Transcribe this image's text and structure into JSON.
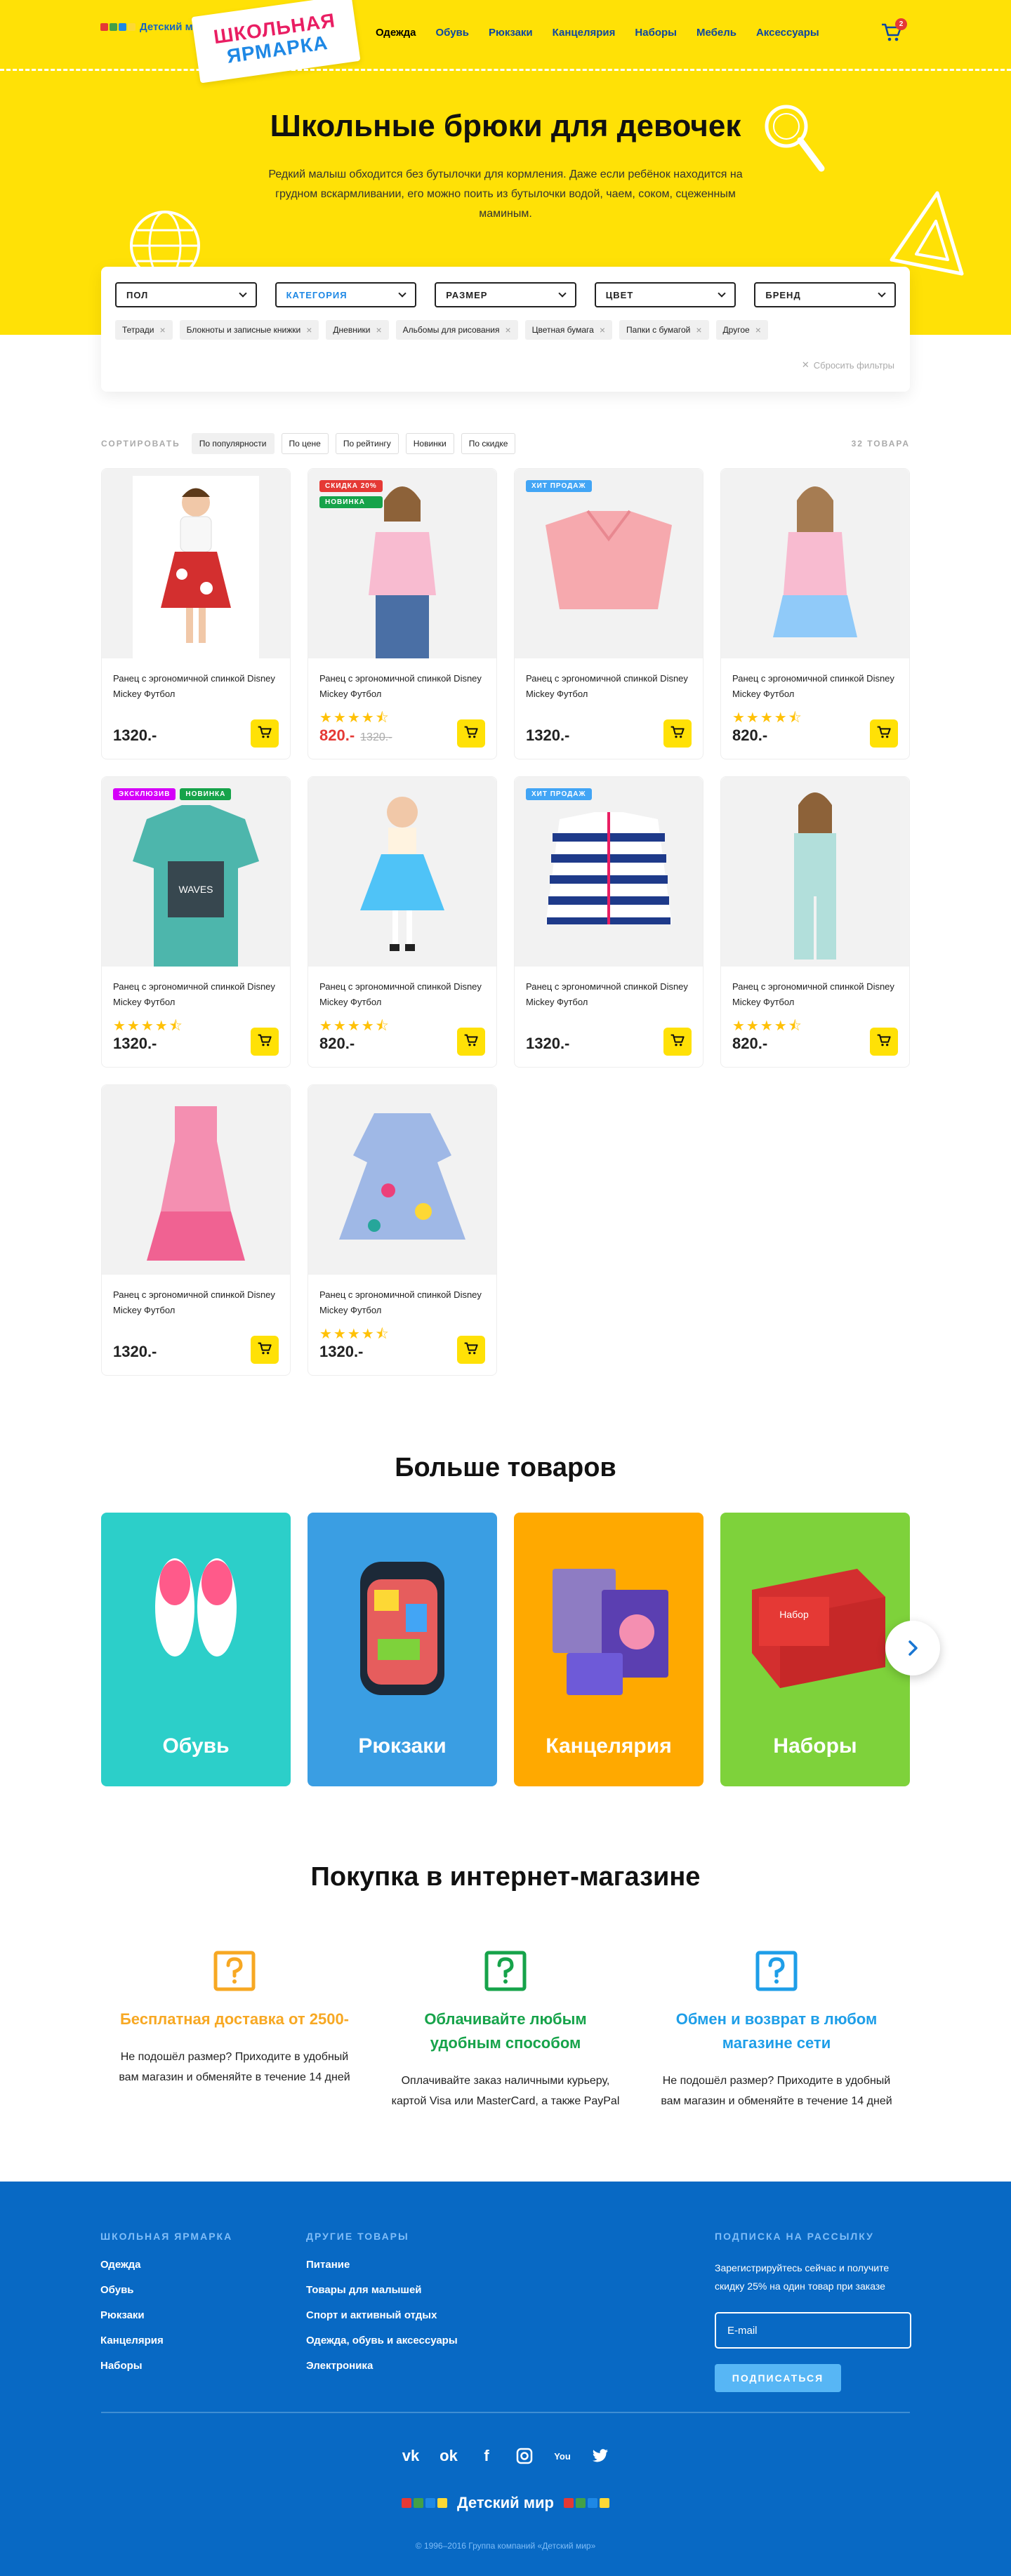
{
  "header": {
    "brand": "Детский мир",
    "badge_line1": "ШКОЛЬНАЯ",
    "badge_line2": "ЯРМАРКА",
    "nav": [
      "Одежда",
      "Обувь",
      "Рюкзаки",
      "Канцелярия",
      "Наборы",
      "Мебель",
      "Аксессуары"
    ],
    "cart_count": "2"
  },
  "hero": {
    "title": "Школьные брюки для девочек",
    "description": "Редкий малыш обходится без бутылочки для кормления. Даже если ребёнок находится на грудном вскармливании, его можно поить из бутылочки водой, чаем, соком, сцеженным маминым."
  },
  "filters": {
    "selects": [
      "ПОЛ",
      "КАТЕГОРИЯ",
      "РАЗМЕР",
      "ЦВЕТ",
      "БРЕНД"
    ],
    "tags": [
      "Тетради",
      "Блокноты и записные книжки",
      "Дневники",
      "Альбомы для рисования",
      "Цветная бумага",
      "Папки с бумагой",
      "Другое"
    ],
    "reset": "Сбросить фильтры"
  },
  "sort": {
    "label": "СОРТИРОВАТЬ",
    "options": [
      "По популярности",
      "По цене",
      "По рейтингу",
      "Новинки",
      "По скидке"
    ],
    "count": "32 ТОВАРА"
  },
  "products": [
    {
      "name": "Ранец с эргономичной спинкой Disney Mickey Футбол",
      "price": "1320.-",
      "old": "",
      "labels": [],
      "rating": 0
    },
    {
      "name": "Ранец с эргономичной спинкой Disney Mickey Футбол",
      "price": "820.-",
      "old": "1320.-",
      "labels": [
        "СКИДКА 20%",
        "НОВИНКА"
      ],
      "rating": 4.5
    },
    {
      "name": "Ранец с эргономичной спинкой Disney Mickey Футбол",
      "price": "1320.-",
      "old": "",
      "labels": [
        "ХИТ ПРОДАЖ"
      ],
      "rating": 0
    },
    {
      "name": "Ранец с эргономичной спинкой Disney Mickey Футбол",
      "price": "820.-",
      "old": "",
      "labels": [],
      "rating": 4.5
    },
    {
      "name": "Ранец с эргономичной спинкой Disney Mickey Футбол",
      "price": "1320.-",
      "old": "",
      "labels": [
        "ЭКСКЛЮЗИВ",
        "НОВИНКА"
      ],
      "rating": 4.5
    },
    {
      "name": "Ранец с эргономичной спинкой Disney Mickey Футбол",
      "price": "820.-",
      "old": "",
      "labels": [],
      "rating": 4.5
    },
    {
      "name": "Ранец с эргономичной спинкой Disney Mickey Футбол",
      "price": "1320.-",
      "old": "",
      "labels": [
        "ХИТ ПРОДАЖ"
      ],
      "rating": 0
    },
    {
      "name": "Ранец с эргономичной спинкой Disney Mickey Футбол",
      "price": "820.-",
      "old": "",
      "labels": [],
      "rating": 4.5
    },
    {
      "name": "Ранец с эргономичной спинкой Disney Mickey Футбол",
      "price": "1320.-",
      "old": "",
      "labels": [],
      "rating": 0
    },
    {
      "name": "Ранец с эргономичной спинкой Disney Mickey Футбол",
      "price": "1320.-",
      "old": "",
      "labels": [],
      "rating": 4.5
    }
  ],
  "more": {
    "title": "Больше товаров",
    "categories": [
      {
        "label": "Обувь",
        "color": "#2ccfc9"
      },
      {
        "label": "Рюкзаки",
        "color": "#3a9ee3"
      },
      {
        "label": "Канцелярия",
        "color": "#ffa900"
      },
      {
        "label": "Наборы",
        "color": "#7ed23b"
      }
    ]
  },
  "purchase": {
    "title": "Покупка в интернет-магазине",
    "features": [
      {
        "title": "Бесплатная доставка от 2500-",
        "text": "Не подошёл размер? Приходите в удобный вам магазин и обменяйте в течение 14 дней",
        "color": "#f7a823"
      },
      {
        "title": "Облачивайте любым удобным способом",
        "text": "Оплачивайте заказ наличными курьеру, картой Visa или MasterCard, а также PayPal",
        "color": "#16a34a"
      },
      {
        "title": "Обмен и возврат в любом магазине сети",
        "text": "Не подошёл размер? Приходите в удобный вам магазин и обменяйте в течение 14 дней",
        "color": "#1e9ee8"
      }
    ]
  },
  "footer": {
    "col1_title": "ШКОЛЬНАЯ ЯРМАРКА",
    "col1": [
      "Одежда",
      "Обувь",
      "Рюкзаки",
      "Канцелярия",
      "Наборы"
    ],
    "col2_title": "ДРУГИЕ ТОВАРЫ",
    "col2": [
      "Питание",
      "Товары для малышей",
      "Спорт и активный отдых",
      "Одежда, обувь и аксессуары",
      "Электроника"
    ],
    "sub_title": "ПОДПИСКА НА РАССЫЛКУ",
    "sub_text": "Зарегистрируйтесь сейчас и получите скидку 25% на один товар при заказе",
    "email_placeholder": "E-mail",
    "sub_button": "ПОДПИСАТЬСЯ",
    "brand": "Детский мир",
    "copyright": "© 1996–2016 Группа компаний «Детский мир»"
  }
}
